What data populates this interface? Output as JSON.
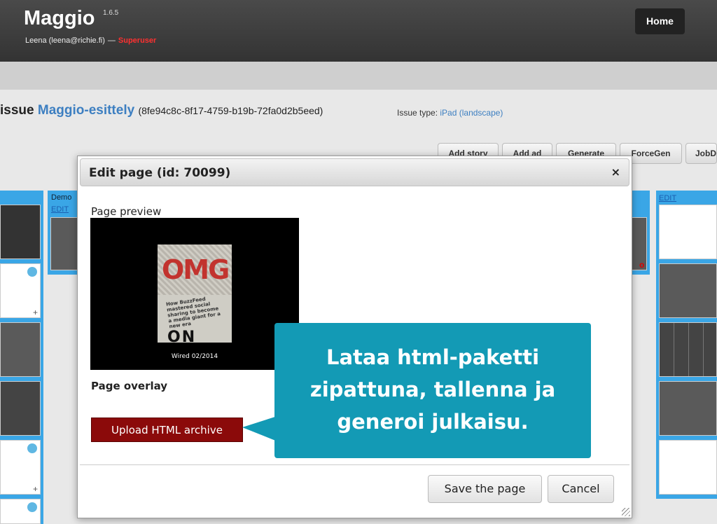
{
  "header": {
    "brand": "Maggio",
    "version": "1.6.5",
    "user": "Leena (leena@richie.fi)",
    "separator": "—",
    "role": "Superuser",
    "home_button": "Home"
  },
  "issue": {
    "prefix": "issue",
    "name": "Maggio-esittely",
    "id": "(8fe94c8c-8f17-4759-b19b-72fa0d2b5eed)",
    "type_label": "Issue type:",
    "type_value": "iPad (landscape)"
  },
  "toolbar": {
    "add_story": "Add story",
    "add_ad": "Add ad",
    "generate": "Generate",
    "forcegen": "ForceGen",
    "jobd": "JobD"
  },
  "columns": {
    "demo_label": "Demo",
    "edit_label": "EDIT",
    "plus": "+",
    "red_mark": "o"
  },
  "modal": {
    "title": "Edit page (id: 70099)",
    "close": "×",
    "preview_label": "Page preview",
    "preview_caption": "Wired 02/2014",
    "cover_headline": "OMG",
    "cover_text": "How BuzzFeed mastered social sharing to become a media giant for a new era",
    "overlay_label": "Page overlay",
    "upload_button": "Upload HTML archive",
    "save_button": "Save the page",
    "cancel_button": "Cancel"
  },
  "callout": {
    "text": "Lataa html-paketti zipattuna, tallenna ja generoi julkaisu.",
    "color": "#139ab5"
  },
  "colors": {
    "accent_blue": "#3aa6e6",
    "link_blue": "#3d7fc1",
    "upload_red": "#8b0a0a",
    "superuser_red": "#ff3030"
  }
}
